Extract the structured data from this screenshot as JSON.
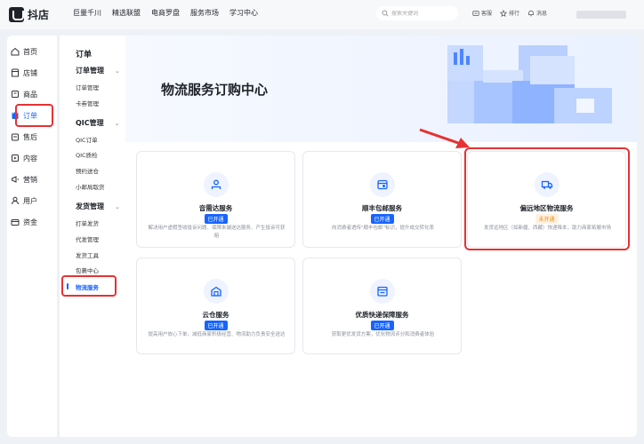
{
  "brand": {
    "name": "抖店"
  },
  "topnav": [
    "巨量千川",
    "精选联盟",
    "电商罗盘",
    "服务市场",
    "学习中心"
  ],
  "search": {
    "placeholder": "搜索关键词"
  },
  "tools": {
    "service": "客服",
    "rank": "排行",
    "message": "消息"
  },
  "sidebar": {
    "items": [
      {
        "label": "首页",
        "icon": "home-icon"
      },
      {
        "label": "店铺",
        "icon": "store-icon"
      },
      {
        "label": "商品",
        "icon": "goods-icon"
      },
      {
        "label": "订单",
        "icon": "order-icon",
        "active": true
      },
      {
        "label": "售后",
        "icon": "after-sale-icon"
      },
      {
        "label": "内容",
        "icon": "content-icon"
      },
      {
        "label": "营销",
        "icon": "marketing-icon"
      },
      {
        "label": "用户",
        "icon": "user-icon"
      },
      {
        "label": "资金",
        "icon": "funds-icon"
      }
    ]
  },
  "submenu": {
    "title": "订单",
    "groups": [
      {
        "label": "订单管理",
        "items": [
          "订单管理",
          "卡券管理"
        ]
      },
      {
        "label": "QIC管理",
        "items": [
          "QIC订单",
          "QIC质检",
          "预约送仓",
          "小邮局取货"
        ]
      },
      {
        "label": "发货管理",
        "items": [
          "打单发货",
          "代发管理",
          "发货工具",
          "包裹中心",
          "物流服务"
        ]
      }
    ]
  },
  "hero": {
    "title": "物流服务订购中心"
  },
  "cards": [
    {
      "name": "音需达服务",
      "badge": "已开通",
      "badge_type": "open",
      "desc": "解决用户虚假签收投诉问题、保障末端送达服务、产生投诉可获赔",
      "icon": "courier-icon"
    },
    {
      "name": "顺丰包邮服务",
      "badge": "已开通",
      "badge_type": "open",
      "desc": "向消费者透传\"顺丰包邮\"标识，提升成交转化率",
      "icon": "sf-express-icon"
    },
    {
      "name": "偏远地区物流服务",
      "badge": "未开通",
      "badge_type": "closed",
      "desc": "发货远地区（如新疆、西藏）快递降本，助力商家拓展市场",
      "icon": "truck-icon"
    },
    {
      "name": "云仓服务",
      "badge": "已开通",
      "badge_type": "open",
      "desc": "提高用户放心下单，减低商家积极经营、物流助力负责安全送达",
      "icon": "cloud-warehouse-icon"
    },
    {
      "name": "优质快递保障服务",
      "badge": "已开通",
      "badge_type": "open",
      "desc": "获取更优发货方案，优化物流评分和消费者体验",
      "icon": "express-guarantee-icon"
    }
  ],
  "colors": {
    "accent": "#1764ff",
    "highlight": "#e63234",
    "closed_badge": "#ff8a00"
  }
}
